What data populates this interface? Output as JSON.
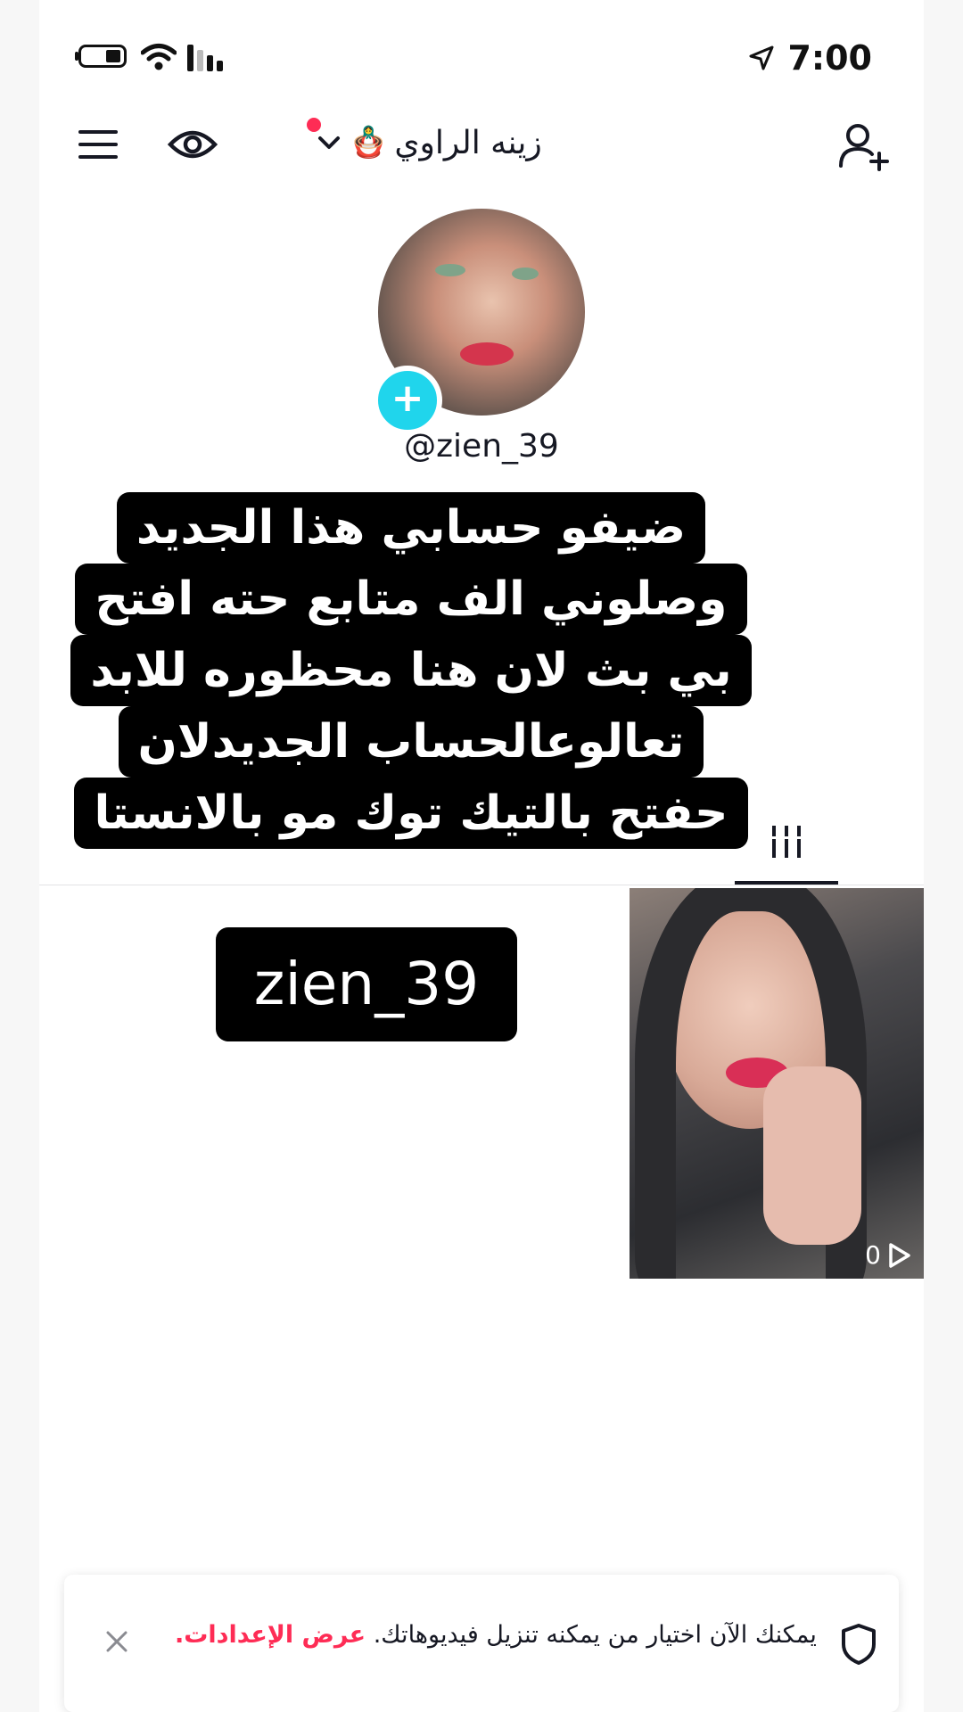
{
  "status_bar": {
    "time": "7:00",
    "icons": [
      "battery-icon",
      "wifi-icon",
      "signal-icon",
      "location-arrow-icon"
    ]
  },
  "header": {
    "account_name": "زينه الراوي",
    "emoji": "🪆",
    "icons": [
      "menu-icon",
      "eye-icon",
      "chevron-down-icon",
      "add-user-icon"
    ],
    "notification_dot_color": "#fe2c55"
  },
  "profile": {
    "username": "@zien_39",
    "add_badge": "+",
    "badge_color": "#20d5ec"
  },
  "caption": {
    "lines": [
      "ضيفو حسابي هذا الجديد",
      "وصلوني الف متابع حته افتح",
      "بي بث لان هنا محظوره للابد",
      "تعالوعالحساب الجديدلان",
      "حفتح بالتيك توك مو بالانستا"
    ]
  },
  "tabs": {
    "active": "grid-tab"
  },
  "content": {
    "tag_text": "zien_39",
    "video": {
      "views": "0"
    }
  },
  "toast": {
    "message": "يمكنك الآن اختيار من يمكنه تنزيل فيديوهاتك.",
    "link": "عرض الإعدادات.",
    "link_color": "#fe2c55"
  }
}
